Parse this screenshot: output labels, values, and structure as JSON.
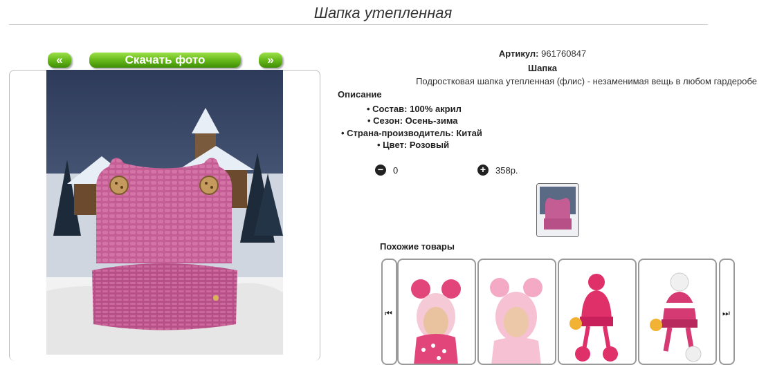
{
  "page": {
    "title": "Шапка утепленная"
  },
  "gallery": {
    "prev_label": "«",
    "download_label": "Скачать фото",
    "next_label": "»"
  },
  "product": {
    "article_label": "Артикул:",
    "article_value": "961760847",
    "type": "Шапка",
    "description": "Подростковая шапка утепленная (флис) - незаменимая вещь в любом гардеробе",
    "description_heading": "Описание",
    "properties": [
      "Состав: 100% акрил",
      "Сезон: Осень-зима",
      "Страна-производитель: Китай",
      "Цвет: Розовый"
    ],
    "quantity": "0",
    "price": "358р."
  },
  "similar": {
    "title": "Похожие товары",
    "prev_icon": "skip-back-icon",
    "next_icon": "skip-forward-icon"
  },
  "colors": {
    "accent_green": "#5aa814",
    "hat_pink": "#c45d93"
  }
}
